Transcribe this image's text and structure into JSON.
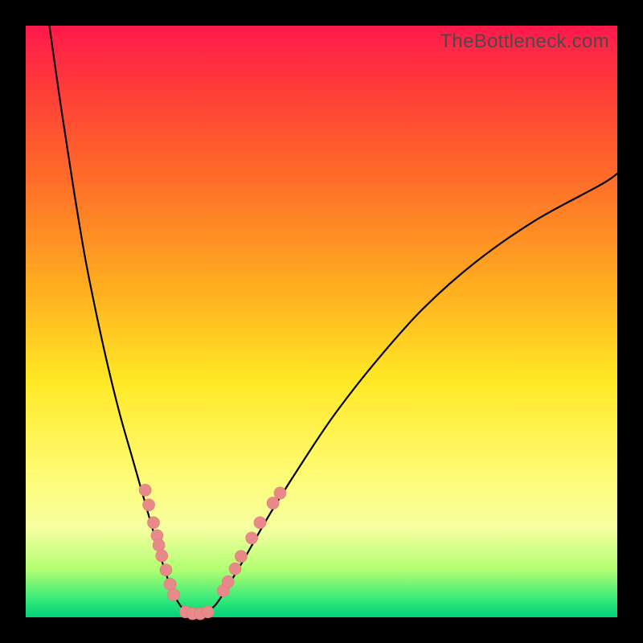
{
  "watermark": "TheBottleneck.com",
  "colors": {
    "frame": "#000000",
    "gradient_top": "#ff1a4d",
    "gradient_bottom": "#00d37a",
    "curve": "#000000",
    "dot": "#e88a8a"
  },
  "chart_data": {
    "type": "line",
    "title": "",
    "xlabel": "",
    "ylabel": "",
    "xlim": [
      0,
      100
    ],
    "ylim": [
      0,
      100
    ],
    "series": [
      {
        "name": "left-curve",
        "x": [
          4,
          6,
          8,
          10,
          12,
          14,
          16,
          18,
          20,
          22,
          23.5,
          25,
          26.5,
          28
        ],
        "y": [
          100,
          86,
          73,
          61,
          51,
          42,
          34,
          27,
          20,
          13,
          8,
          4,
          1.5,
          0.5
        ]
      },
      {
        "name": "right-curve",
        "x": [
          30,
          32,
          34,
          37,
          41,
          46,
          52,
          59,
          67,
          76,
          86,
          97,
          100
        ],
        "y": [
          0.5,
          2,
          5,
          10,
          17,
          25,
          34,
          43,
          52,
          60,
          67,
          73,
          75
        ]
      }
    ],
    "dots_left": [
      {
        "x": 20.2,
        "y": 21.5
      },
      {
        "x": 20.8,
        "y": 19.0
      },
      {
        "x": 21.6,
        "y": 16.0
      },
      {
        "x": 22.2,
        "y": 13.8
      },
      {
        "x": 22.5,
        "y": 12.2
      },
      {
        "x": 23.0,
        "y": 10.4
      },
      {
        "x": 23.7,
        "y": 8.0
      },
      {
        "x": 24.4,
        "y": 5.6
      },
      {
        "x": 25.0,
        "y": 3.8
      }
    ],
    "dots_bottom": [
      {
        "x": 27.0,
        "y": 0.9
      },
      {
        "x": 28.2,
        "y": 0.6
      },
      {
        "x": 29.5,
        "y": 0.6
      },
      {
        "x": 30.8,
        "y": 0.9
      }
    ],
    "dots_right": [
      {
        "x": 33.4,
        "y": 4.5
      },
      {
        "x": 34.2,
        "y": 6.0
      },
      {
        "x": 35.4,
        "y": 8.2
      },
      {
        "x": 36.4,
        "y": 10.3
      },
      {
        "x": 38.2,
        "y": 13.4
      },
      {
        "x": 39.6,
        "y": 16.0
      },
      {
        "x": 41.8,
        "y": 19.3
      },
      {
        "x": 43.0,
        "y": 21.0
      }
    ]
  }
}
